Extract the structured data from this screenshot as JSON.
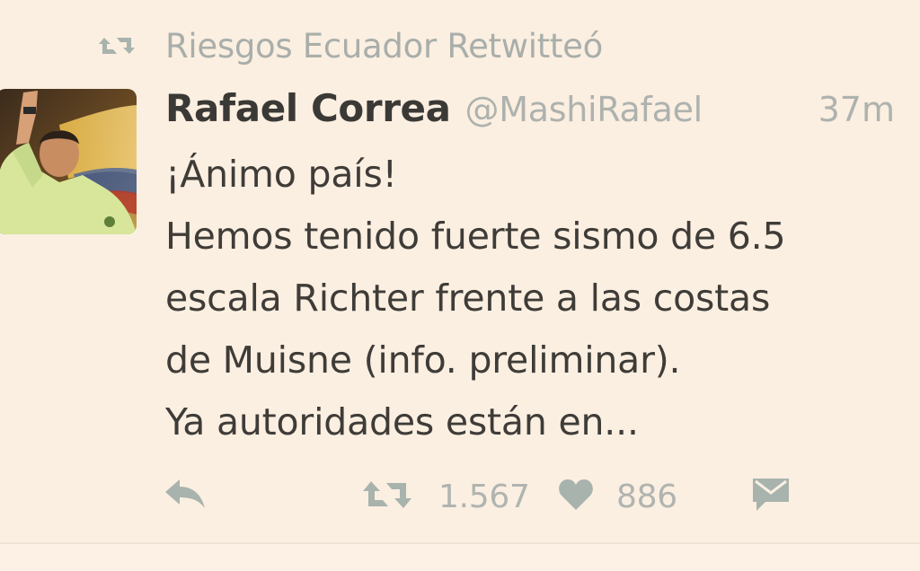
{
  "retweet_context": {
    "icon": "retweet-icon",
    "text": "Riesgos Ecuador Retwitteó"
  },
  "tweet": {
    "author": {
      "display_name": "Rafael Correa",
      "handle": "@MashiRafael",
      "avatar": "avatar-photo"
    },
    "timestamp": "37m",
    "text_lines": [
      "¡Ánimo país!",
      "Hemos tenido fuerte sismo de 6.5",
      "escala Richter frente a las costas",
      "de Muisne (info. preliminar).",
      "Ya autoridades están en..."
    ],
    "actions": {
      "reply": {
        "icon": "reply-icon"
      },
      "retweet": {
        "icon": "retweet-icon",
        "count": "1.567"
      },
      "favorite": {
        "icon": "heart-icon",
        "count": "886"
      },
      "message": {
        "icon": "envelope-icon"
      }
    }
  },
  "colors": {
    "background": "#fbefe1",
    "icon_gray": "#a8b3ad",
    "text_dark": "#3b3834",
    "text_muted": "#aeb2ae"
  }
}
